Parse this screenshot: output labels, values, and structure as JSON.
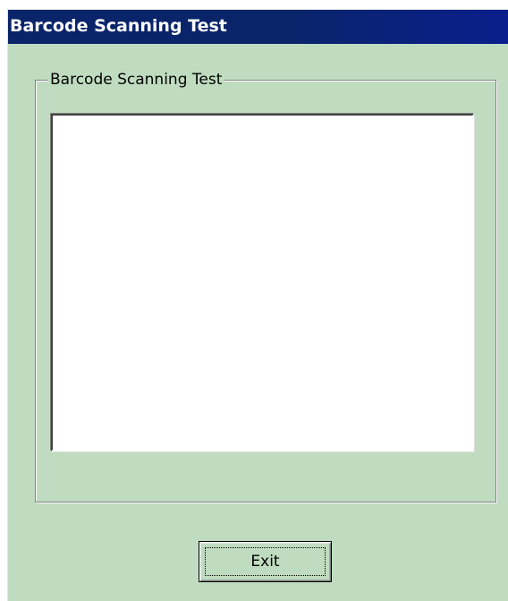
{
  "window": {
    "title": "Barcode Scanning Test"
  },
  "groupbox": {
    "label": "Barcode Scanning Test"
  },
  "scan_list": {
    "items": []
  },
  "buttons": {
    "exit_label": "Exit"
  },
  "colors": {
    "titlebar": "#0a246a",
    "window_background": "#c0dcc0",
    "list_background": "#ffffff"
  }
}
